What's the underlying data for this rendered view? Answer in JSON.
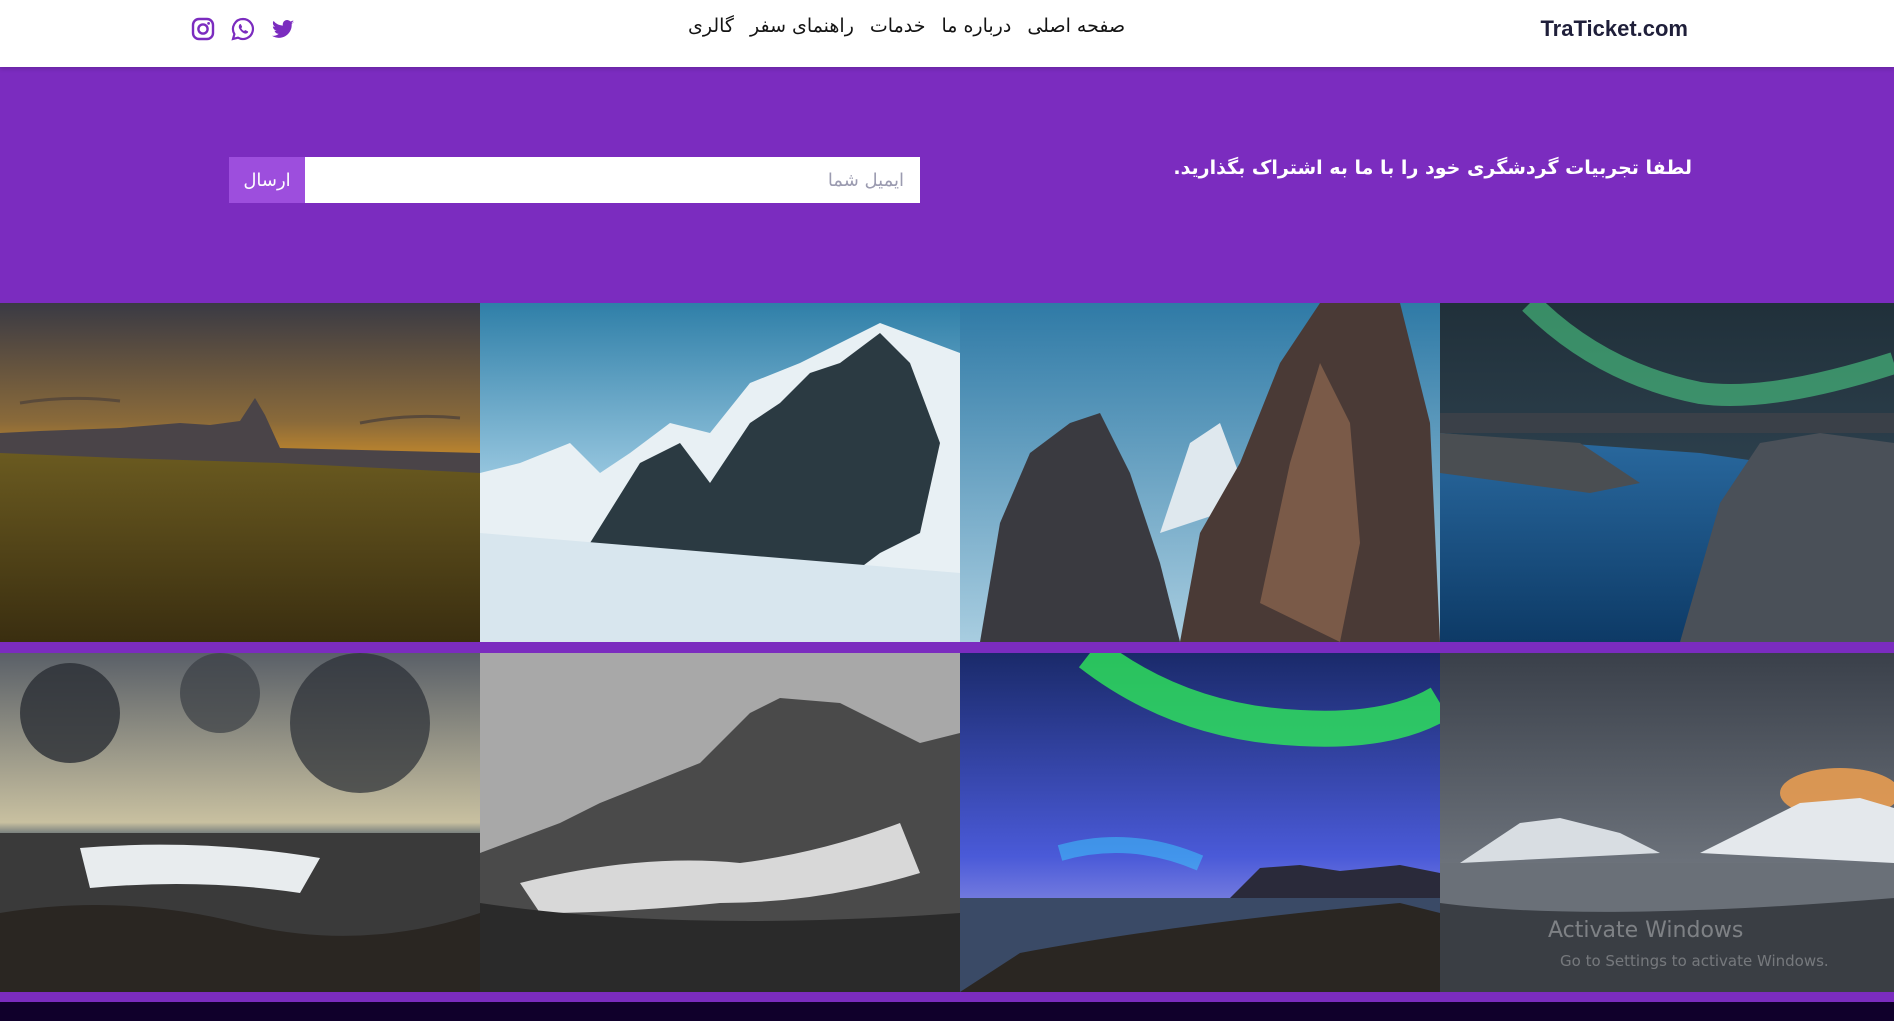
{
  "header": {
    "brand": "TraTicket.com",
    "nav": [
      {
        "label": "صفحه اصلی"
      },
      {
        "label": "درباره ما"
      },
      {
        "label": "خدمات"
      },
      {
        "label": "راهنمای سفر"
      },
      {
        "label": "گالری"
      }
    ],
    "social_icons": [
      "instagram-icon",
      "whatsapp-icon",
      "twitter-icon"
    ]
  },
  "hero": {
    "message": "لطفا تجربیات گردشگری خود را با ما به اشتراک بگذارید.",
    "email_placeholder": "ایمیل شما",
    "email_value": "",
    "submit_label": "ارسال"
  },
  "gallery": {
    "photos": [
      {
        "subject": "grassland-sunset"
      },
      {
        "subject": "snowy-mountain-peaks"
      },
      {
        "subject": "rocky-cliff-peaks"
      },
      {
        "subject": "aurora-over-canyon"
      },
      {
        "subject": "stormy-seashore-waves"
      },
      {
        "subject": "misty-mountain"
      },
      {
        "subject": "aurora-over-beach"
      },
      {
        "subject": "snowy-coast-sunset"
      }
    ]
  },
  "watermark": {
    "title": "Activate Windows",
    "subtitle": "Go to Settings to activate Windows."
  },
  "colors": {
    "primary": "#7b2cbf",
    "button": "#9d4edd",
    "footer": "#10002b",
    "header_bg": "#ffffff"
  }
}
